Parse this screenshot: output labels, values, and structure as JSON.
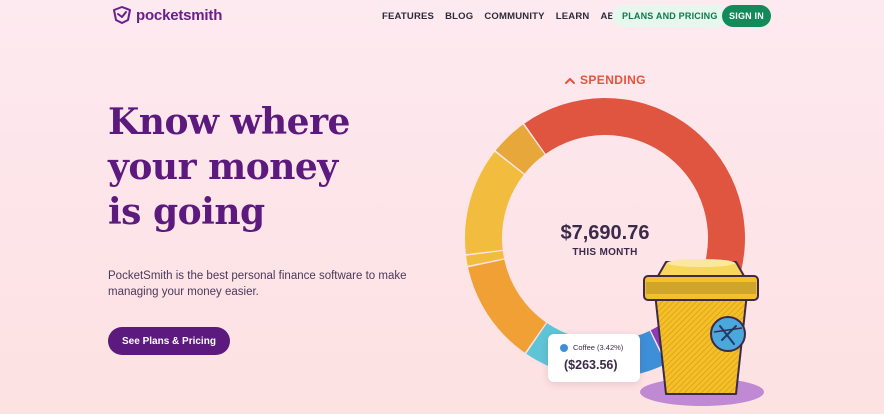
{
  "brand": {
    "name": "pocketsmith"
  },
  "nav": {
    "links": [
      "FEATURES",
      "BLOG",
      "COMMUNITY",
      "LEARN",
      "ABOUT"
    ],
    "plans_label": "PLANS AND PRICING",
    "signin_label": "SIGN IN"
  },
  "hero": {
    "title_lines": [
      "Know where",
      "your money",
      "is going"
    ],
    "subtitle": "PocketSmith is the best personal finance software to make managing your money easier.",
    "cta_label": "See Plans & Pricing"
  },
  "spending": {
    "label": "SPENDING",
    "total": "$7,690.76",
    "period": "THIS MONTH",
    "segments": [
      {
        "color": "#e05540",
        "share": 0.344
      },
      {
        "color": "#8e3ab0",
        "share": 0.125
      },
      {
        "color": "#3d8fd8",
        "share": 0.055
      },
      {
        "color": "#5fc5d6",
        "share": 0.095
      },
      {
        "color": "#f0a035",
        "share": 0.108
      },
      {
        "color": "#f2bd3e",
        "share": 0.012
      },
      {
        "color": "#f2bd3e",
        "share": 0.112
      },
      {
        "color": "#e8a73a",
        "share": 0.04
      }
    ]
  },
  "tooltip": {
    "label": "Coffee (3.42%)",
    "value": "($263.56)",
    "dot_color": "#3d8fd8"
  },
  "colors": {
    "brand_purple": "#5c1a7e",
    "accent_green": "#138a5a",
    "spending_red": "#e6533c"
  }
}
